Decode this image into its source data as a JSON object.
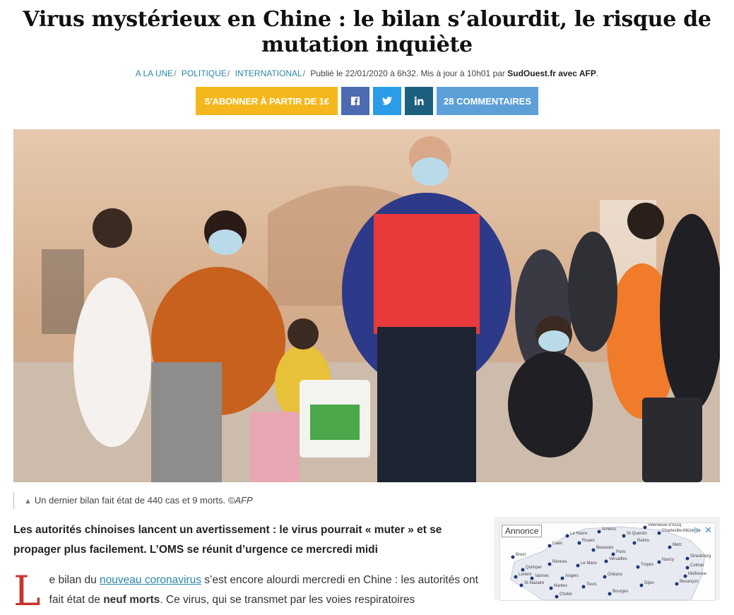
{
  "article": {
    "title": "Virus mystérieux en Chine : le bilan s’alourdit, le risque de mutation inquiète",
    "breadcrumbs": [
      "A LA UNE",
      "POLITIQUE",
      "INTERNATIONAL"
    ],
    "published_prefix": "Publié le 22/01/2020 à 6h32. Mis à jour à 10h01 par",
    "published_author": "SudOuest.fr avec AFP",
    "published_suffix": ".",
    "image_caption": "Un dernier bilan fait état de 440 cas et 9 morts.",
    "image_credit": "©AFP",
    "lead": "Les autorités chinoises lancent un avertissement : le virus pourrait « muter » et se propager plus facilement. L’OMS se réunit d’urgence ce mercredi midi",
    "dropcap": "L",
    "body_1": "e bilan du ",
    "body_link": "nouveau coronavirus",
    "body_2": " s’est encore alourdi mercredi en Chine : les autorités ont fait état de ",
    "body_bold": "neuf morts",
    "body_3": ". Ce virus, qui se transmet par les voies respiratoires"
  },
  "actions": {
    "subscribe": "S'ABONNER À PARTIR DE 1€",
    "comments": "28 COMMENTAIRES",
    "facebook_icon": "facebook-icon",
    "twitter_icon": "twitter-icon",
    "linkedin_icon": "linkedin-icon"
  },
  "ad": {
    "label": "Annonce",
    "close": "✕",
    "play": "▷",
    "cities": [
      "Le Havre",
      "Amiens",
      "St-Quentin",
      "Charleville-Mézières",
      "Villeneuve d'Ascq",
      "Caen",
      "Rouen",
      "Beauvais",
      "Reims",
      "Metz",
      "Brest",
      "Paris",
      "Versailles",
      "Nancy",
      "Strasbourg",
      "Quimper",
      "Rennes",
      "Le Mans",
      "Troyes",
      "Colmar",
      "Lorient",
      "Vannes",
      "Angers",
      "Orléans",
      "Mulhouse",
      "St-Nazaire",
      "Nantes",
      "Tours",
      "Dijon",
      "Besançon",
      "Bourges",
      "Cholet"
    ]
  },
  "colors": {
    "accent": "#2a86a8",
    "subscribe": "#f5b81c",
    "facebook": "#4d6bb0",
    "twitter": "#2a9ce8",
    "linkedin": "#1d5f7e",
    "comments": "#5da0d8",
    "dropcap": "#c8342a"
  }
}
